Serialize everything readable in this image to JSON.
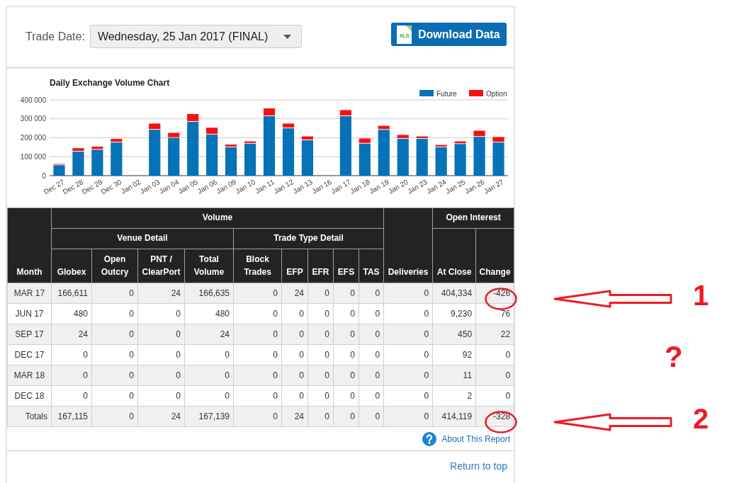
{
  "trade_date": {
    "label": "Trade Date:",
    "value": "Wednesday, 25 Jan 2017 (FINAL)"
  },
  "download_button": {
    "label": "Download Data",
    "icon_text": "XLS"
  },
  "chart": {
    "chart_data": [
      {
        "type": "bar",
        "title": "Daily Exchange Volume Chart",
        "stacked": true,
        "legend": "top-right",
        "grid": true,
        "categories": [
          "Dec 27",
          "Dec 28",
          "Dec 29",
          "Dec 30",
          "Jan 02",
          "Jan 03",
          "Jan 04",
          "Jan 05",
          "Jan 06",
          "Jan 09",
          "Jan 10",
          "Jan 11",
          "Jan 12",
          "Jan 13",
          "Jan 16",
          "Jan 17",
          "Jan 18",
          "Jan 19",
          "Jan 20",
          "Jan 23",
          "Jan 24",
          "Jan 25",
          "Jan 26",
          "Jan 27"
        ],
        "series": [
          {
            "name": "Future",
            "color": "#0672b8",
            "values": [
              55000,
              127000,
              137000,
              175000,
              null,
              242000,
              199000,
              284000,
              217000,
              150000,
              169000,
              314000,
              250000,
              187000,
              null,
              314000,
              169000,
              242000,
              194000,
              194000,
              150000,
              167000,
              205000,
              175000
            ]
          },
          {
            "name": "Option",
            "color": "#f90f0f",
            "values": [
              7000,
              18000,
              16000,
              19000,
              null,
              33000,
              27000,
              41000,
              36000,
              14000,
              12000,
              41000,
              25000,
              20000,
              null,
              32000,
              27000,
              21000,
              21000,
              13000,
              12000,
              14000,
              32000,
              29000
            ]
          }
        ],
        "ylim": [
          0,
          400000
        ],
        "yticks": [
          {
            "value": 0,
            "label": "0"
          },
          {
            "value": 100000,
            "label": "100 000"
          },
          {
            "value": 200000,
            "label": "200 000"
          },
          {
            "value": 300000,
            "label": "300 000"
          },
          {
            "value": 400000,
            "label": "400 000"
          }
        ]
      }
    ]
  },
  "table": {
    "column_groups": [
      {
        "label": "Month"
      },
      {
        "label": "Volume",
        "children": [
          {
            "label": "Venue Detail",
            "children": [
              {
                "label": "Globex"
              },
              {
                "label": "Open Outcry"
              },
              {
                "label": "PNT / ClearPort"
              },
              {
                "label": "Total Volume"
              }
            ]
          },
          {
            "label": "Trade Type Detail",
            "children": [
              {
                "label": "Block Trades"
              },
              {
                "label": "EFP"
              },
              {
                "label": "EFR"
              },
              {
                "label": "EFS"
              },
              {
                "label": "TAS"
              }
            ]
          }
        ]
      },
      {
        "label": "Deliveries"
      },
      {
        "label": "Open Interest",
        "children": [
          {
            "label": "At Close"
          },
          {
            "label": "Change"
          }
        ]
      }
    ],
    "rows": [
      {
        "kind": "month",
        "label": "MAR 17",
        "cells": [
          "166,611",
          "0",
          "24",
          "166,635",
          "0",
          "24",
          "0",
          "0",
          "0",
          "0",
          "404,334",
          "-426"
        ],
        "circled": true,
        "annotation": {
          "kind": "arrow",
          "label": "1"
        }
      },
      {
        "kind": "month",
        "label": "JUN 17",
        "cells": [
          "480",
          "0",
          "0",
          "480",
          "0",
          "0",
          "0",
          "0",
          "0",
          "0",
          "9,230",
          "76"
        ],
        "circled": false
      },
      {
        "kind": "month",
        "label": "SEP 17",
        "cells": [
          "24",
          "0",
          "0",
          "24",
          "0",
          "0",
          "0",
          "0",
          "0",
          "0",
          "450",
          "22"
        ],
        "circled": false
      },
      {
        "kind": "month",
        "label": "DEC 17",
        "cells": [
          "0",
          "0",
          "0",
          "0",
          "0",
          "0",
          "0",
          "0",
          "0",
          "0",
          "92",
          "0"
        ],
        "circled": false,
        "annotation": {
          "kind": "note",
          "label": "?"
        }
      },
      {
        "kind": "month",
        "label": "MAR 18",
        "cells": [
          "0",
          "0",
          "0",
          "0",
          "0",
          "0",
          "0",
          "0",
          "0",
          "0",
          "11",
          "0"
        ],
        "circled": false
      },
      {
        "kind": "month",
        "label": "DEC 18",
        "cells": [
          "0",
          "0",
          "0",
          "0",
          "0",
          "0",
          "0",
          "0",
          "0",
          "0",
          "2",
          "0"
        ],
        "circled": false
      },
      {
        "kind": "total",
        "label": "Totals",
        "cells": [
          "167,115",
          "0",
          "24",
          "167,139",
          "0",
          "24",
          "0",
          "0",
          "0",
          "0",
          "414,119",
          "-328"
        ],
        "circled": true,
        "annotation": {
          "kind": "arrow",
          "label": "2"
        }
      }
    ]
  },
  "about_link": "About This Report",
  "return_link": "Return to top"
}
